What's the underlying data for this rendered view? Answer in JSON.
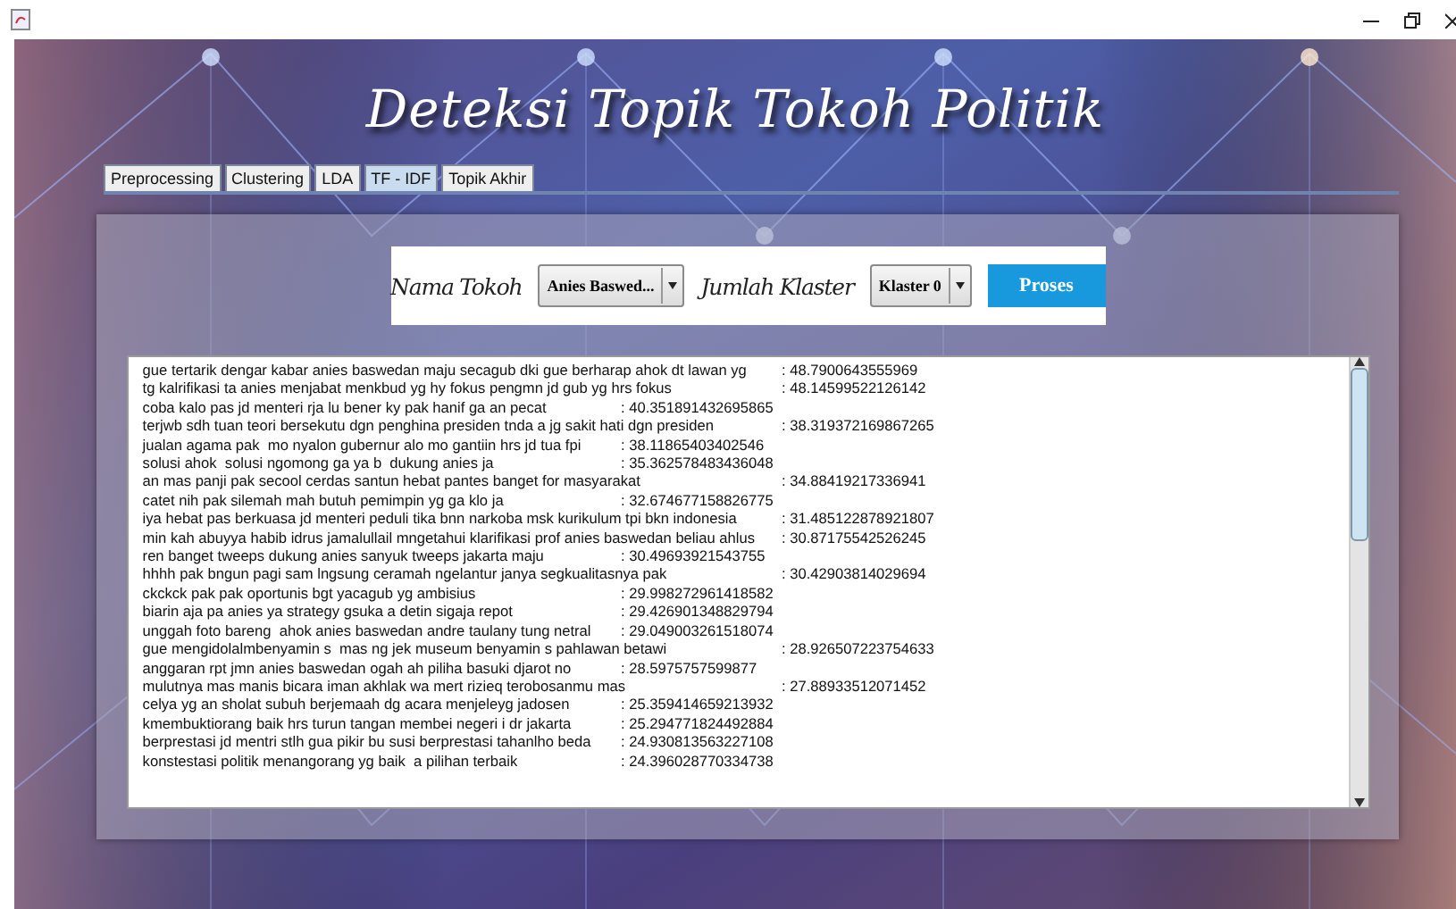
{
  "window": {
    "title": "Deteksi Topik Tokoh Politik"
  },
  "tabs": [
    {
      "label": "Preprocessing",
      "selected": false
    },
    {
      "label": "Clustering",
      "selected": false
    },
    {
      "label": "LDA",
      "selected": false
    },
    {
      "label": "TF - IDF",
      "selected": true
    },
    {
      "label": "Topik Akhir",
      "selected": false
    }
  ],
  "controls": {
    "tokoh_label": "Nama Tokoh",
    "tokoh_value": "Anies Baswed...",
    "klaster_label": "Jumlah Klaster",
    "klaster_value": "Klaster 0",
    "button": "Proses"
  },
  "results": [
    {
      "text": "gue tertarik dengar kabar anies baswedan maju secagub dki gue berharap ahok dt lawan yg",
      "score": ": 48.7900643555969"
    },
    {
      "text": "tg kalrifikasi ta anies menjabat menkbud yg hy fokus pengmn jd gub yg hrs fokus",
      "score": ": 48.14599522126142"
    },
    {
      "text": "coba kalo pas jd menteri rja lu bener ky pak hanif ga an pecat",
      "score": ": 40.351891432695865"
    },
    {
      "text": "terjwb sdh tuan teori bersekutu dgn penghina presiden tnda a jg sakit hati dgn presiden",
      "score": ": 38.319372169867265"
    },
    {
      "text": "jualan agama pak  mo nyalon gubernur alo mo gantiin hrs jd tua fpi",
      "score": ": 38.11865403402546"
    },
    {
      "text": "solusi ahok  solusi ngomong ga ya b  dukung anies ja",
      "score": ": 35.362578483436048"
    },
    {
      "text": "an mas panji pak secool cerdas santun hebat pantes banget for masyarakat",
      "score": ": 34.88419217336941"
    },
    {
      "text": "catet nih pak silemah mah butuh pemimpin yg ga klo ja",
      "score": ": 32.674677158826775"
    },
    {
      "text": "iya hebat pas berkuasa jd menteri peduli tika bnn narkoba msk kurikulum tpi bkn indonesia",
      "score": ": 31.485122878921807"
    },
    {
      "text": "min kah abuyya habib idrus jamalullail mngetahui klarifikasi prof anies baswedan beliau ahlus",
      "score": ": 30.87175542526245"
    },
    {
      "text": "ren banget tweeps dukung anies sanyuk tweeps jakarta maju",
      "score": ": 30.49693921543755"
    },
    {
      "text": "hhhh pak bngun pagi sam lngsung ceramah ngelantur janya segkualitasnya pak",
      "score": ": 30.42903814029694"
    },
    {
      "text": "ckckck pak pak oportunis bgt yacagub yg ambisius",
      "score": ": 29.998272961418582"
    },
    {
      "text": "biarin aja pa anies ya strategy gsuka a detin sigaja repot",
      "score": ": 29.426901348829794"
    },
    {
      "text": "unggah foto bareng  ahok anies baswedan andre taulany tung netral",
      "score": ": 29.049003261518074"
    },
    {
      "text": "gue mengidolalmbenyamin s  mas ng jek museum benyamin s pahlawan betawi",
      "score": ": 28.926507223754633"
    },
    {
      "text": "anggaran rpt jmn anies baswedan ogah ah piliha basuki djarot no",
      "score": ": 28.5975757599877"
    },
    {
      "text": "mulutnya mas manis bicara iman akhlak wa mert rizieq terobosanmu mas",
      "score": ": 27.88933512071452"
    },
    {
      "text": "celya yg an sholat subuh berjemaah dg acara menjeleyg jadosen",
      "score": ": 25.359414659213932"
    },
    {
      "text": "kmembuktiorang baik hrs turun tangan membei negeri i dr jakarta",
      "score": ": 25.294771824492884"
    },
    {
      "text": "berprestasi jd mentri stlh gua pikir bu susi berprestasi tahanlho beda",
      "score": ": 24.930813563227108"
    },
    {
      "text": "konstestasi politik menangorang yg baik  a pilihan terbaik",
      "score": ": 24.396028770334738"
    }
  ]
}
